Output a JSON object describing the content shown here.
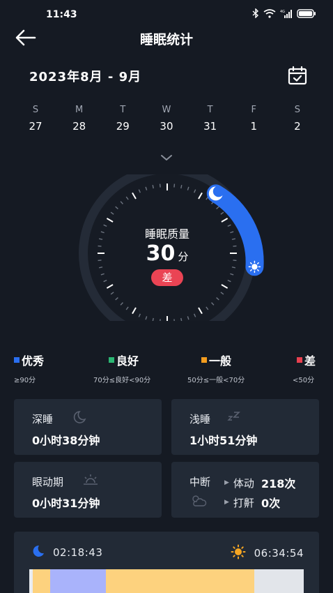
{
  "status": {
    "time": "11:43",
    "network": "4G"
  },
  "nav": {
    "title": "睡眠统计"
  },
  "date_range": "2023年8月 - 9月",
  "week": [
    {
      "letter": "S",
      "day": "27"
    },
    {
      "letter": "M",
      "day": "28"
    },
    {
      "letter": "T",
      "day": "29"
    },
    {
      "letter": "W",
      "day": "30"
    },
    {
      "letter": "T",
      "day": "31"
    },
    {
      "letter": "F",
      "day": "1"
    },
    {
      "letter": "S",
      "day": "2"
    }
  ],
  "quality": {
    "title": "睡眠质量",
    "score": "30",
    "unit": "分",
    "grade": "差"
  },
  "legend": [
    {
      "label": "优秀",
      "range": "≥90分",
      "color": "#2a6ff0"
    },
    {
      "label": "良好",
      "range": "70分≤良好<90分",
      "color": "#2bb673"
    },
    {
      "label": "一般",
      "range": "50分≤一般<70分",
      "color": "#f39c1e"
    },
    {
      "label": "差",
      "range": "<50分",
      "color": "#e8404f"
    }
  ],
  "cards": {
    "deep": {
      "label": "深睡",
      "value": "0小时38分钟",
      "icon": "moon-icon"
    },
    "light": {
      "label": "浅睡",
      "value": "1小时51分钟",
      "icon": "zz-icon"
    },
    "rem": {
      "label": "眼动期",
      "value": "0小时31分钟",
      "icon": "sunrise-icon"
    },
    "interrupt": {
      "label": "中断",
      "movement_label": "体动",
      "movement_value": "218次",
      "snore_label": "打鼾",
      "snore_value": "0次"
    }
  },
  "timeline": {
    "start": "02:18:43",
    "end": "06:34:54",
    "segments": [
      {
        "stage": "awake",
        "fraction": 0.013,
        "color": "#e9ecf1"
      },
      {
        "stage": "light",
        "fraction": 0.064,
        "color": "#fdd27e"
      },
      {
        "stage": "rem",
        "fraction": 0.202,
        "color": "#a9b3fb"
      },
      {
        "stage": "light",
        "fraction": 0.54,
        "color": "#fdd27e"
      },
      {
        "stage": "awake",
        "fraction": 0.181,
        "color": "#e2e5ea"
      }
    ]
  },
  "colors": {
    "background": "#151a23",
    "card": "#222a36",
    "accent": "#2a6ff0",
    "grade_poor": "#ea4454"
  }
}
